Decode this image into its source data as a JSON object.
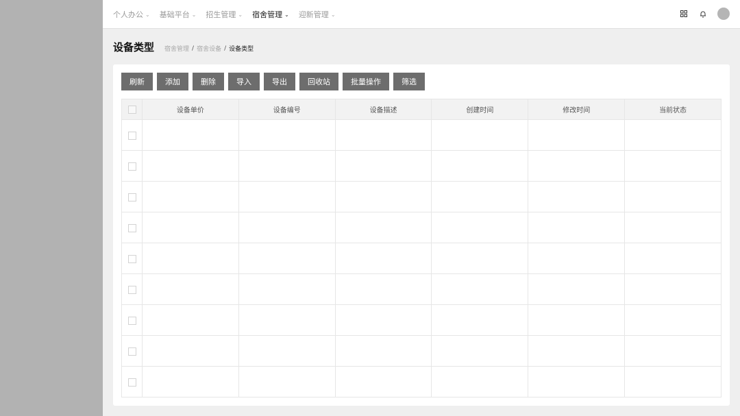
{
  "nav": {
    "items": [
      {
        "label": "个人办公",
        "active": false
      },
      {
        "label": "基础平台",
        "active": false
      },
      {
        "label": "招生管理",
        "active": false
      },
      {
        "label": "宿舍管理",
        "active": true
      },
      {
        "label": "迎新管理",
        "active": false
      }
    ]
  },
  "top_icons": [
    "grid-icon",
    "bell-icon",
    "avatar"
  ],
  "page": {
    "title": "设备类型",
    "breadcrumb": [
      "宿舍管理",
      "宿舍设备",
      "设备类型"
    ],
    "breadcrumb_sep": "/"
  },
  "toolbar": {
    "buttons": [
      "刷新",
      "添加",
      "删除",
      "导入",
      "导出",
      "回收站",
      "批量操作",
      "筛选"
    ]
  },
  "table": {
    "columns": [
      "设备单价",
      "设备编号",
      "设备描述",
      "创建时间",
      "修改时间",
      "当前状态"
    ],
    "row_count": 9
  },
  "colors": {
    "sidebar": "#b2b2b2",
    "button": "#6d6d6d",
    "header_bg": "#f2f2f2"
  }
}
